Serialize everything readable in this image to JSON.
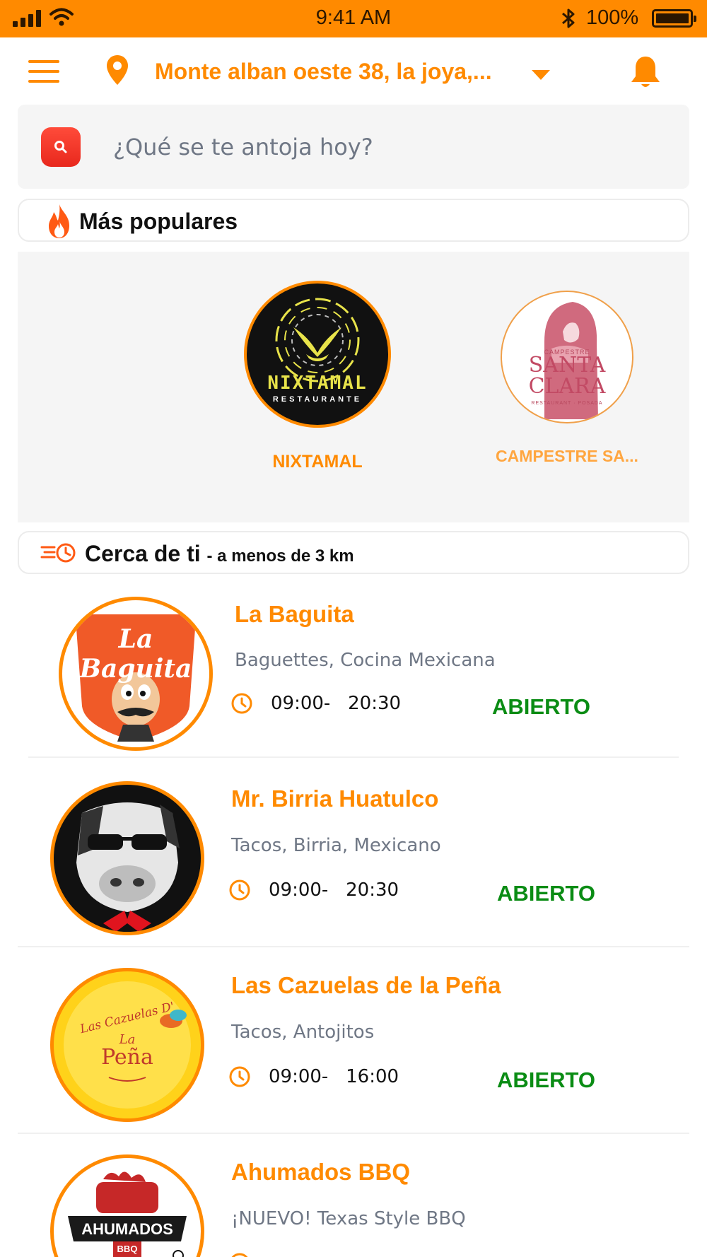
{
  "status_bar": {
    "time": "9:41 AM",
    "battery": "100%"
  },
  "header": {
    "address": "Monte alban oeste 38, la joya,..."
  },
  "search": {
    "placeholder": "¿Qué se te antoja hoy?"
  },
  "popular": {
    "title": "Más populares",
    "items": [
      {
        "name": "NIXTAMAL",
        "logo_text": "NIXTAMAL",
        "logo_sub": "RESTAURANTE"
      },
      {
        "name": "CAMPESTRE SA...",
        "logo_top": "CAMPESTRE",
        "logo_text1": "SANTA",
        "logo_text2": "CLARA",
        "logo_sub": "RESTAURANT · POSADA"
      }
    ]
  },
  "nearby": {
    "title": "Cerca de ti",
    "subtitle": "- a menos de 3 km",
    "restaurants": [
      {
        "name": "La Baguita",
        "categories": "Baguettes, Cocina Mexicana",
        "hours": "09:00-   20:30",
        "status": "ABIERTO",
        "logo_text": "La Baguita"
      },
      {
        "name": "Mr. Birria Huatulco",
        "categories": "Tacos, Birria, Mexicano",
        "hours": "09:00-   20:30",
        "status": "ABIERTO"
      },
      {
        "name": "Las Cazuelas de la Peña",
        "categories": "Tacos, Antojitos",
        "hours": "09:00-   16:00",
        "status": "ABIERTO",
        "logo_text1": "Las Cazuelas D'",
        "logo_text2": "La",
        "logo_text3": "Peña"
      },
      {
        "name": "Ahumados BBQ",
        "categories": "¡NUEVO! Texas Style BBQ",
        "logo_text": "AHUMADOS",
        "logo_sub": "BBQ"
      }
    ]
  },
  "colors": {
    "accent": "#FF8A00",
    "open_status": "#0a8c14",
    "search_button": "#e8281d"
  }
}
